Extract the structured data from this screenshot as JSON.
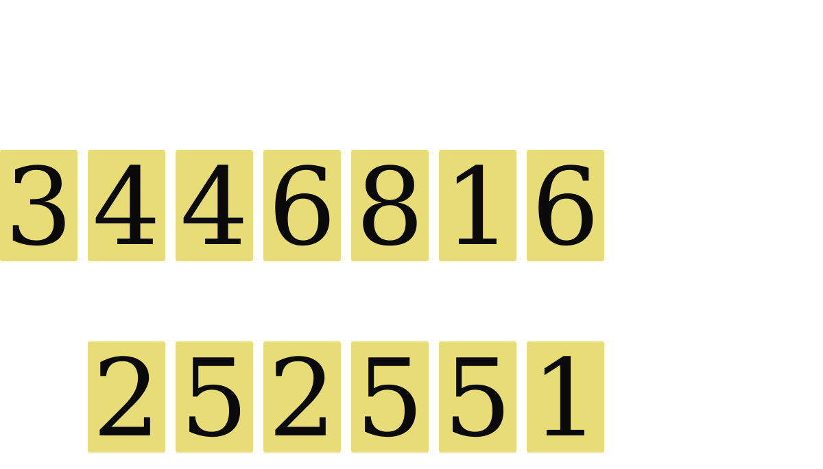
{
  "colors": {
    "tile_background": "#e8dc76",
    "digit": "#0a0a0a",
    "page_background": "#ffffff"
  },
  "top_row": {
    "digits": [
      "3",
      "4",
      "4",
      "6",
      "8",
      "1",
      "6"
    ]
  },
  "bottom_row": {
    "digits": [
      "2",
      "5",
      "2",
      "5",
      "5",
      "1"
    ]
  }
}
